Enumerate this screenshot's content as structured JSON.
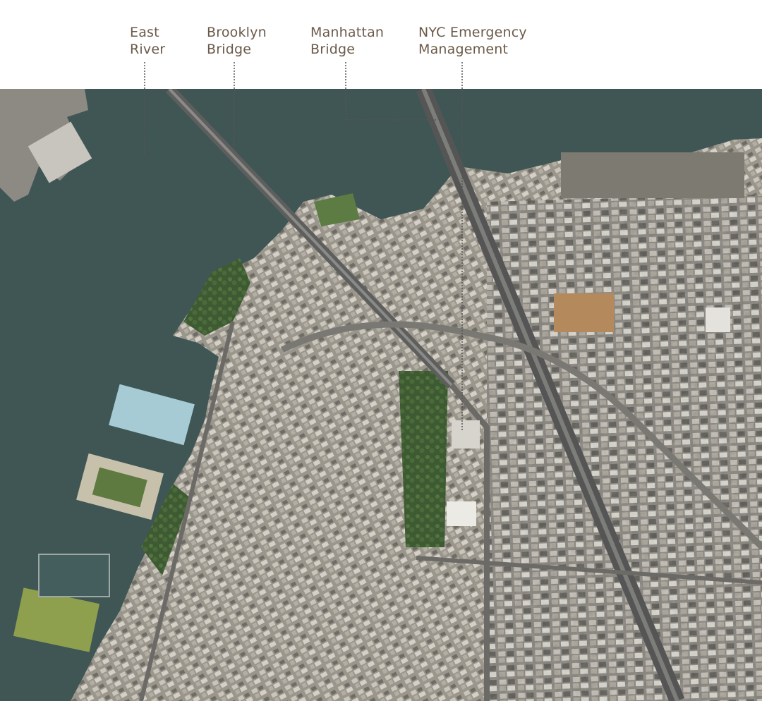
{
  "callouts": [
    {
      "id": "east-river",
      "lines": [
        "East",
        "River"
      ]
    },
    {
      "id": "brooklyn-bridge",
      "lines": [
        "Brooklyn",
        "Bridge"
      ]
    },
    {
      "id": "manhattan-bridge",
      "lines": [
        "Manhattan",
        "Bridge"
      ]
    },
    {
      "id": "nyc-emergency-management",
      "lines": [
        "NYC Emergency",
        "Management"
      ]
    }
  ],
  "colors": {
    "label_text": "#6b5a4a",
    "leader_line": "#555555",
    "water": "#3f5654",
    "land": "#8e8b83",
    "park": "#3f6b36",
    "bridge": "#5a5a5a"
  }
}
